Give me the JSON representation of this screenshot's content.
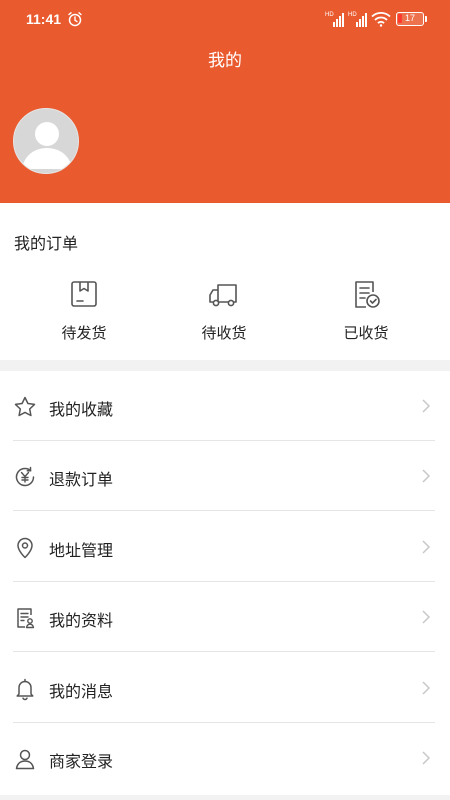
{
  "status_bar": {
    "time": "11:41",
    "battery": "17",
    "battery_level": 0.17,
    "icons": [
      "alarm-icon",
      "signal-icon",
      "signal-icon",
      "wifi-icon",
      "battery-icon"
    ]
  },
  "header": {
    "title": "我的",
    "username": ""
  },
  "orders": {
    "title": "我的订单",
    "items": [
      {
        "label": "待发货",
        "icon": "package-box-icon"
      },
      {
        "label": "待收货",
        "icon": "delivery-truck-icon"
      },
      {
        "label": "已收货",
        "icon": "receipt-check-icon"
      }
    ]
  },
  "menu": {
    "items": [
      {
        "label": "我的收藏",
        "icon": "star-icon"
      },
      {
        "label": "退款订单",
        "icon": "yen-refund-icon"
      },
      {
        "label": "地址管理",
        "icon": "location-pin-icon"
      },
      {
        "label": "我的资料",
        "icon": "profile-document-icon"
      },
      {
        "label": "我的消息",
        "icon": "bell-icon"
      },
      {
        "label": "商家登录",
        "icon": "user-icon"
      }
    ]
  },
  "colors": {
    "header_bg": "#ea5a2f",
    "page_bg": "#f2f2f2",
    "icon_stroke": "#555555",
    "chevron": "#c8c8c8"
  }
}
